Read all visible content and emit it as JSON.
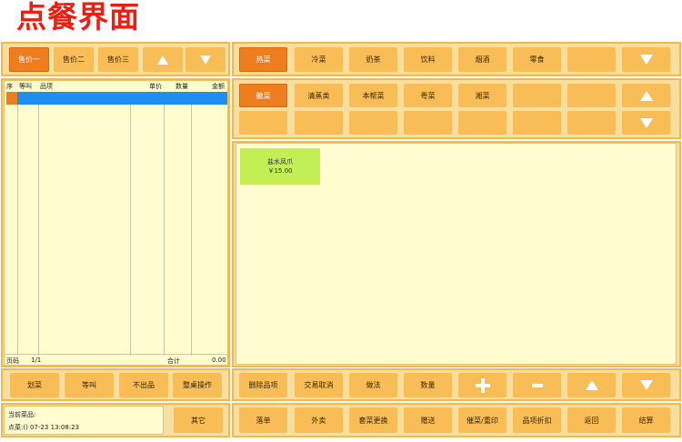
{
  "page_title": "点餐界面",
  "price_tabs": [
    "售价一",
    "售价二",
    "售价三"
  ],
  "categories": [
    "热菜",
    "冷菜",
    "奶茶",
    "饮料",
    "烟酒",
    "零食",
    "",
    ""
  ],
  "subcategories": [
    "徽菜",
    "清蒸类",
    "本帮菜",
    "粤菜",
    "湘菜",
    "",
    "",
    "",
    "",
    "",
    "",
    "",
    "",
    ""
  ],
  "order_table": {
    "headers": [
      "序",
      "等叫",
      "品项",
      "单价",
      "数量",
      "金额"
    ],
    "page_label": "页码",
    "page_value": "1/1",
    "total_label": "合计",
    "total_value": "0.00"
  },
  "dishes": [
    {
      "name": "盐水凤爪",
      "price": "￥15.00"
    }
  ],
  "left_actions": [
    "划菜",
    "等叫",
    "不出品",
    "整桌操作"
  ],
  "right_actions": [
    "删除品项",
    "交易取消",
    "做法",
    "数量"
  ],
  "bottom_actions": [
    "落单",
    "外卖",
    "套菜更换",
    "赠送",
    "催菜/重印",
    "品项折扣",
    "返回",
    "结算"
  ],
  "other_button": "其它",
  "info_panel": {
    "current_dish_label": "当前菜品:",
    "order_time": "点菜:() 07-23 13:08:23"
  },
  "colors": {
    "title": "#f21b0f",
    "button": "#f8bd57",
    "active": "#ee7d1e",
    "selected_row": "#1e8ff0",
    "dish_tile": "#c3ee54"
  }
}
